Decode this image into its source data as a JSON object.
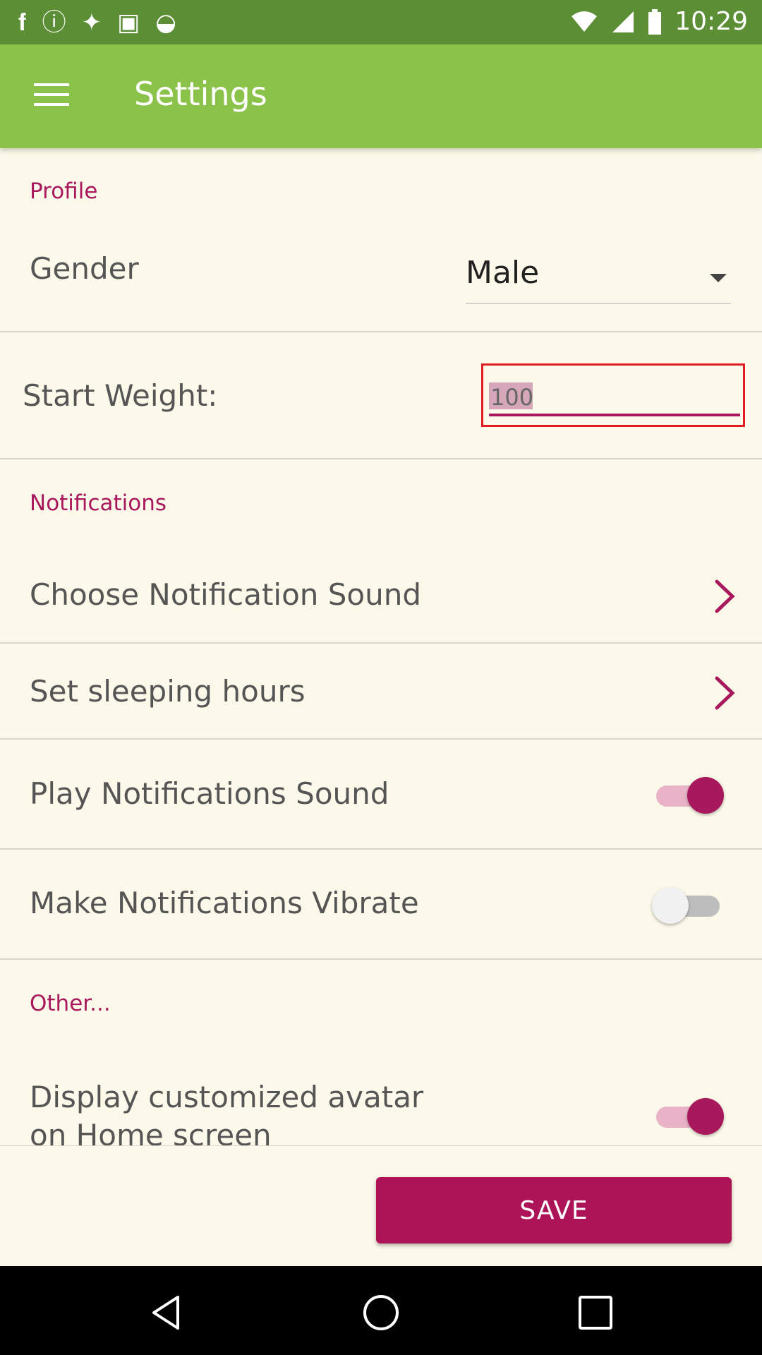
{
  "status_bar": {
    "time": "10:29",
    "icons": [
      "facebook-icon",
      "notification-icon",
      "satellite-icon",
      "lock-icon",
      "android-icon",
      "wifi-icon",
      "signal-icon",
      "battery-icon"
    ]
  },
  "toolbar": {
    "menu_icon": "menu-icon",
    "title": "Settings"
  },
  "profile": {
    "header": "Profile",
    "gender_label": "Gender",
    "gender_value": "Male",
    "start_weight_label": "Start Weight:",
    "start_weight_value": "100"
  },
  "notifications": {
    "header": "Notifications",
    "choose_sound_label": "Choose Notification Sound",
    "sleeping_hours_label": "Set sleeping hours",
    "play_sound_label": "Play Notifications Sound",
    "play_sound_on": true,
    "vibrate_label": "Make Notifications Vibrate",
    "vibrate_on": false
  },
  "other": {
    "header": "Other...",
    "avatar_label_line1": "Display customized avatar",
    "avatar_label_line2": "on Home screen",
    "avatar_on": true
  },
  "actions": {
    "save_label": "SAVE"
  },
  "colors": {
    "status_bar": "#5c8f35",
    "toolbar": "#8bc34a",
    "accent": "#a8185c",
    "background": "#fdf9ea",
    "highlight_border": "#e31b23"
  }
}
